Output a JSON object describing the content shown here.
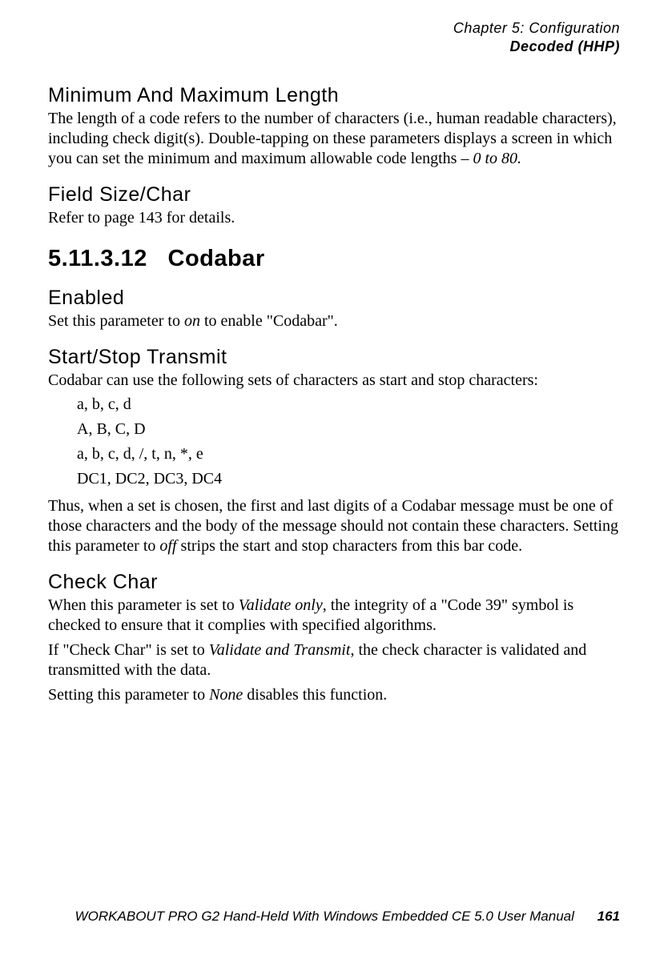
{
  "header": {
    "chapter": "Chapter 5: Configuration",
    "section": "Decoded (HHP)"
  },
  "sections": {
    "minmax": {
      "title": "Minimum And Maximum Length",
      "p1a": "The length of a code refers to the number of characters (i.e., human readable characters), including check digit(s). Double-tapping on these parameters displays a screen in which you can set the minimum and maximum allowable code lengths – ",
      "p1b_italic": "0 to 80.",
      "p1c": ""
    },
    "fieldsize": {
      "title": "Field Size/Char",
      "p1": "Refer to page 143 for details."
    },
    "codabar_num": "5.11.3.12",
    "codabar_title": "Codabar",
    "enabled": {
      "title": "Enabled",
      "p1a": "Set this parameter to ",
      "p1b_italic": "on",
      "p1c": " to enable \"Codabar\"."
    },
    "startstop": {
      "title": "Start/Stop Transmit",
      "p1": "Codabar can use the following sets of characters as start and stop characters:",
      "chars": [
        "a, b, c, d",
        "A, B, C, D",
        "a, b, c, d, /, t, n, *, e",
        "DC1, DC2, DC3, DC4"
      ],
      "p2a": "Thus, when a set is chosen, the first and last digits of a Codabar message must be one of those characters and the body of the message should not contain these characters. Setting this parameter to ",
      "p2b_italic": "off",
      "p2c": " strips the start and stop characters from this bar code."
    },
    "checkchar": {
      "title": "Check Char",
      "p1a": "When this parameter is set to ",
      "p1b_italic": "Validate only",
      "p1c": ", the integrity of a \"Code 39\" symbol is checked to ensure that it complies with specified algorithms.",
      "p2a": "If \"Check Char\" is set to ",
      "p2b_italic": "Validate and Transmit",
      "p2c": ", the check character is validated and transmitted with the data.",
      "p3a": "Setting this parameter to ",
      "p3b_italic": "None",
      "p3c": " disables this function."
    }
  },
  "footer": {
    "text": "WORKABOUT PRO G2 Hand-Held With Windows Embedded CE 5.0 User Manual",
    "page": "161"
  }
}
